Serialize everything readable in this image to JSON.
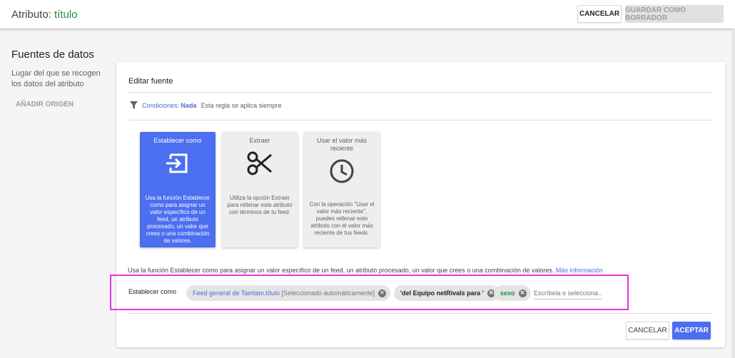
{
  "header": {
    "title_prefix": "Atributo: ",
    "title_attr": "título",
    "cancel_label": "CANCELAR",
    "save_draft_label": "GUARDAR COMO BORRADOR"
  },
  "sidebar": {
    "heading": "Fuentes de datos",
    "description": "Lugar del que se recogen los datos del atributo",
    "add_origin_label": "AÑADIR ORIGEN"
  },
  "editor": {
    "title": "Editar fuente",
    "conditions_label": "Condiciones:",
    "conditions_value": "Nada",
    "conditions_note": "Esta regla se aplica siempre",
    "tiles": [
      {
        "title": "Establecer como",
        "description": "Usa la función Establecer como para asignar un valor específico de un feed, un atributo procesado, un valor que crees o una combinación de valores.",
        "icon": "input-arrow-icon",
        "selected": true
      },
      {
        "title": "Extraer",
        "description": "Utiliza la opción Extraer para rellenar este atributo con términos de tu feed.",
        "icon": "scissors-icon",
        "selected": false
      },
      {
        "title": "Usar el valor más reciente",
        "description": "Con la operación \"Usar el valor más reciente\", puedes rellenar este atributo con el valor más reciente de tus feeds.",
        "icon": "clock-icon",
        "selected": false
      }
    ],
    "explanation": "Usa la función Establecer como para asignar un valor específico de un feed, un atributo procesado, un valor que crees o una combinación de valores.",
    "more_info": "Más información",
    "set_as_label": "Establecer como",
    "chips": [
      {
        "feed": "Feed general de Tamtam.",
        "field": "título",
        "note": "[Seleccionado automáticamente]"
      },
      {
        "text": "'del Equipo netRivals para '"
      },
      {
        "text": "sexo"
      }
    ],
    "chip_input_placeholder": "Escríbela o selecciona...",
    "cancel_label": "CANCELAR",
    "accept_label": "ACEPTAR"
  },
  "colors": {
    "accent_blue": "#4c6ef0",
    "link_blue": "#4a6cd8",
    "attr_green": "#1e8e3e",
    "highlight_magenta": "#e633e6"
  }
}
